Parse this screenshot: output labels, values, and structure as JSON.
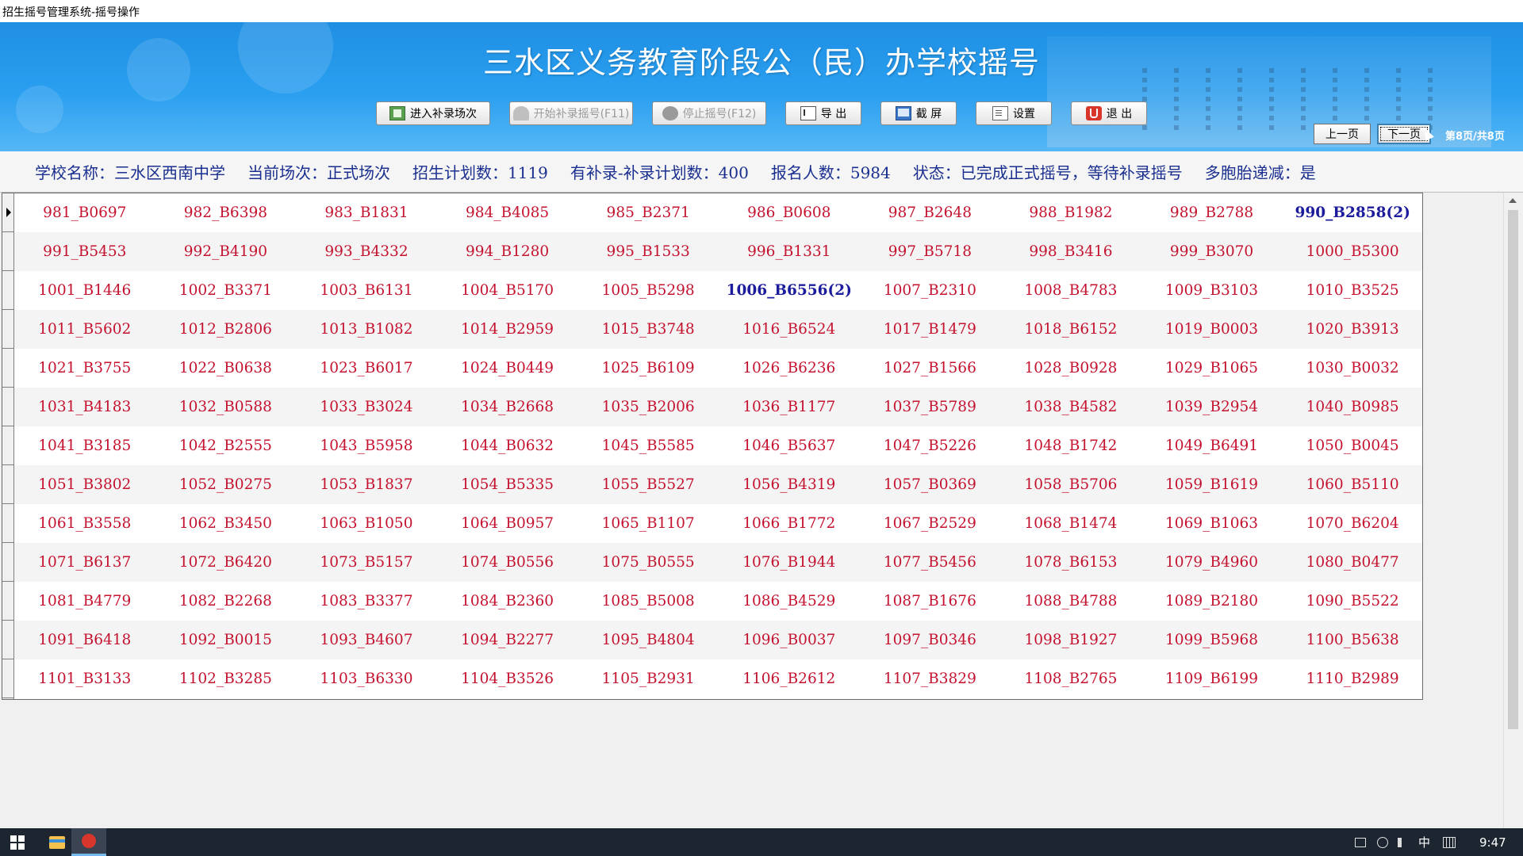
{
  "window": {
    "title": "招生摇号管理系统-摇号操作"
  },
  "header": {
    "title": "三水区义务教育阶段公（民）办学校摇号",
    "buttons": {
      "enter_supplement": "进入补录场次",
      "start_supplement": "开始补录摇号(F11)",
      "stop": "停止摇号(F12)",
      "export": "导 出",
      "screenshot": "截 屏",
      "settings": "设置",
      "exit": "退 出"
    },
    "pager": {
      "prev": "上一页",
      "next": "下一页",
      "indicator": "第8页/共8页"
    }
  },
  "info": {
    "school": "学校名称：三水区西南中学",
    "session": "当前场次：正式场次",
    "plan": "招生计划数：1119",
    "supplement": "有补录-补录计划数：400",
    "applicants": "报名人数：5984",
    "status": "状态：已完成正式摇号，等待补录摇号",
    "multiple_births": "多胞胎递减：是"
  },
  "grid": {
    "rows": [
      [
        "981_B0697",
        "982_B6398",
        "983_B1831",
        "984_B4085",
        "985_B2371",
        "986_B0608",
        "987_B2648",
        "988_B1982",
        "989_B2788",
        "990_B2858(2)"
      ],
      [
        "991_B5453",
        "992_B4190",
        "993_B4332",
        "994_B1280",
        "995_B1533",
        "996_B1331",
        "997_B5718",
        "998_B3416",
        "999_B3070",
        "1000_B5300"
      ],
      [
        "1001_B1446",
        "1002_B3371",
        "1003_B6131",
        "1004_B5170",
        "1005_B5298",
        "1006_B6556(2)",
        "1007_B2310",
        "1008_B4783",
        "1009_B3103",
        "1010_B3525"
      ],
      [
        "1011_B5602",
        "1012_B2806",
        "1013_B1082",
        "1014_B2959",
        "1015_B3748",
        "1016_B6524",
        "1017_B1479",
        "1018_B6152",
        "1019_B0003",
        "1020_B3913"
      ],
      [
        "1021_B3755",
        "1022_B0638",
        "1023_B6017",
        "1024_B0449",
        "1025_B6109",
        "1026_B6236",
        "1027_B1566",
        "1028_B0928",
        "1029_B1065",
        "1030_B0032"
      ],
      [
        "1031_B4183",
        "1032_B0588",
        "1033_B3024",
        "1034_B2668",
        "1035_B2006",
        "1036_B1177",
        "1037_B5789",
        "1038_B4582",
        "1039_B2954",
        "1040_B0985"
      ],
      [
        "1041_B3185",
        "1042_B2555",
        "1043_B5958",
        "1044_B0632",
        "1045_B5585",
        "1046_B5637",
        "1047_B5226",
        "1048_B1742",
        "1049_B6491",
        "1050_B0045"
      ],
      [
        "1051_B3802",
        "1052_B0275",
        "1053_B1837",
        "1054_B5335",
        "1055_B5527",
        "1056_B4319",
        "1057_B0369",
        "1058_B5706",
        "1059_B1619",
        "1060_B5110"
      ],
      [
        "1061_B3558",
        "1062_B3450",
        "1063_B1050",
        "1064_B0957",
        "1065_B1107",
        "1066_B1772",
        "1067_B2529",
        "1068_B1474",
        "1069_B1063",
        "1070_B6204"
      ],
      [
        "1071_B6137",
        "1072_B6420",
        "1073_B5157",
        "1074_B0556",
        "1075_B0555",
        "1076_B1944",
        "1077_B5456",
        "1078_B6153",
        "1079_B4960",
        "1080_B0477"
      ],
      [
        "1081_B4779",
        "1082_B2268",
        "1083_B3377",
        "1084_B2360",
        "1085_B5008",
        "1086_B4529",
        "1087_B1676",
        "1088_B4788",
        "1089_B2180",
        "1090_B5522"
      ],
      [
        "1091_B6418",
        "1092_B0015",
        "1093_B4607",
        "1094_B2277",
        "1095_B4804",
        "1096_B0037",
        "1097_B0346",
        "1098_B1927",
        "1099_B5968",
        "1100_B5638"
      ],
      [
        "1101_B3133",
        "1102_B3285",
        "1103_B6330",
        "1104_B3526",
        "1105_B2931",
        "1106_B2612",
        "1107_B3829",
        "1108_B2765",
        "1109_B6199",
        "1110_B2989"
      ]
    ],
    "highlighted": [
      "990_B2858(2)",
      "1006_B6556(2)"
    ]
  },
  "taskbar": {
    "time": "9:47",
    "ime": "中"
  },
  "colors": {
    "header_blue": "#2a9ff0",
    "info_text": "#1a2f8f",
    "cell_text": "#c4122f",
    "highlight_text": "#1c1c9c"
  }
}
